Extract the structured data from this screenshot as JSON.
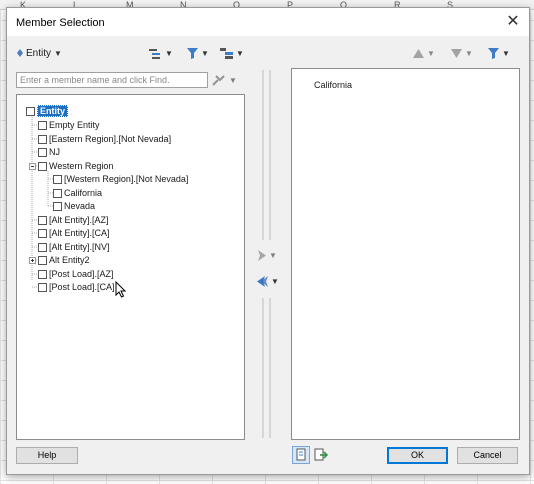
{
  "background": {
    "column_letters": [
      "K",
      "L",
      "M",
      "N",
      "O",
      "P",
      "Q",
      "R",
      "S"
    ]
  },
  "dialog": {
    "title": "Member Selection",
    "close_glyph": "✕"
  },
  "toolbar": {
    "dimension_label": "Entity",
    "find_placeholder": "Enter a member name and click Find."
  },
  "tree": {
    "items": [
      {
        "label": "Entity"
      },
      {
        "label": "Empty Entity"
      },
      {
        "label": "[Eastern Region].[Not Nevada]"
      },
      {
        "label": "NJ"
      },
      {
        "label": "Western Region"
      },
      {
        "label": "[Western Region].[Not Nevada]"
      },
      {
        "label": "California"
      },
      {
        "label": "Nevada"
      },
      {
        "label": "[Alt Entity].[AZ]"
      },
      {
        "label": "[Alt Entity].[CA]"
      },
      {
        "label": "[Alt Entity].[NV]"
      },
      {
        "label": "Alt Entity2"
      },
      {
        "label": "[Post Load].[AZ]"
      },
      {
        "label": "[Post Load].[CA]"
      }
    ]
  },
  "selection": {
    "items": [
      "California"
    ]
  },
  "footer": {
    "help_label": "Help",
    "ok_label": "OK",
    "cancel_label": "Cancel"
  },
  "icons": {
    "dimension": "dimension-icon",
    "view_members": "member-view-icon",
    "filter": "filter-icon",
    "layout": "hierarchy-layout-icon",
    "find": "find-tool-icon",
    "move_up": "move-up-icon",
    "move_down": "move-down-icon",
    "filter_right": "filter-icon",
    "add": "add-arrow-icon",
    "remove": "remove-arrow-icon",
    "list_view": "list-view-icon",
    "export": "export-icon"
  },
  "colors": {
    "selection_highlight": "#1b6ec2",
    "ok_border": "#0078d7",
    "dialog_bg": "#f0f0f0"
  }
}
